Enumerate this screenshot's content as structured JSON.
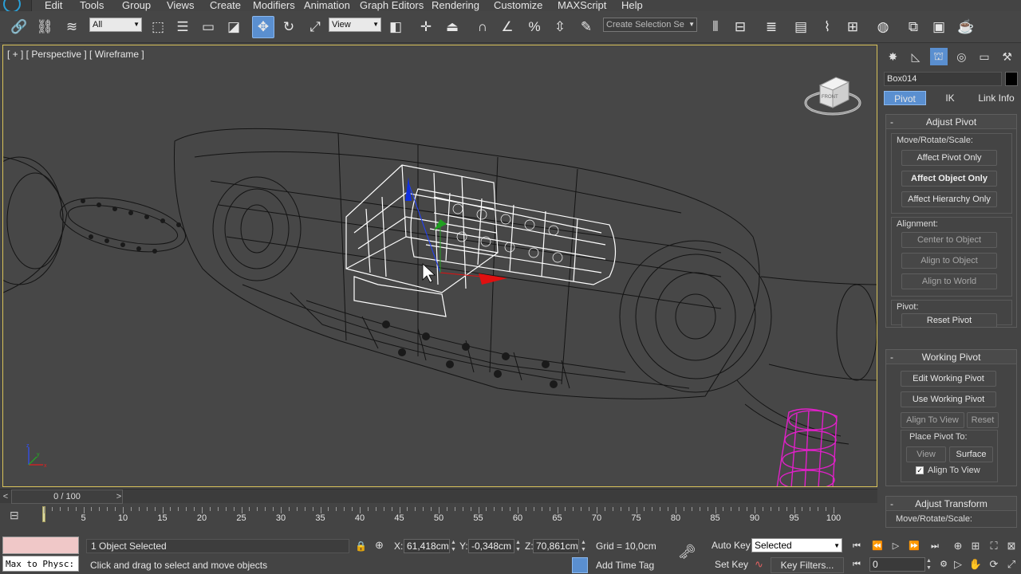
{
  "menu": [
    "Edit",
    "Tools",
    "Group",
    "Views",
    "Create",
    "Modifiers",
    "Animation",
    "Graph Editors",
    "Rendering",
    "Customize",
    "MAXScript",
    "Help"
  ],
  "toolbar": {
    "selection_filter": "All",
    "ref_coord": "View",
    "named_selection_set": "Create Selection Se"
  },
  "viewport": {
    "label": "[ + ] [ Perspective ] [ Wireframe ]",
    "viewcube_face": "FRONT",
    "axis_labels": [
      "x",
      "y",
      "z"
    ]
  },
  "command_panel": {
    "object_name": "Box014",
    "subtabs": [
      "Pivot",
      "IK",
      "Link Info"
    ],
    "active_subtab": "Pivot",
    "adjust_pivot": {
      "title": "Adjust Pivot",
      "move_label": "Move/Rotate/Scale:",
      "affect_pivot_only": "Affect Pivot Only",
      "affect_object_only": "Affect Object Only",
      "affect_hierarchy_only": "Affect Hierarchy Only",
      "alignment_label": "Alignment:",
      "center_to_object": "Center to Object",
      "align_to_object": "Align to Object",
      "align_to_world": "Align to World",
      "pivot_label": "Pivot:",
      "reset_pivot": "Reset Pivot"
    },
    "working_pivot": {
      "title": "Working Pivot",
      "edit_working_pivot": "Edit Working Pivot",
      "use_working_pivot": "Use Working Pivot",
      "align_to_view": "Align To View",
      "reset": "Reset",
      "place_pivot_label": "Place Pivot To:",
      "view": "View",
      "surface": "Surface",
      "align_to_view_checkbox": "Align To View",
      "align_to_view_checked": true
    },
    "adjust_transform": {
      "title": "Adjust Transform",
      "move_label": "Move/Rotate/Scale:"
    },
    "minus": "-"
  },
  "timeline": {
    "slider_text": "0 / 100",
    "prev": "<",
    "next": ">",
    "ticks": [
      5,
      10,
      15,
      20,
      25,
      30,
      35,
      40,
      45,
      50,
      55,
      60,
      65,
      70,
      75,
      80,
      85,
      90,
      95,
      100
    ],
    "current_frame": 0
  },
  "status": {
    "maxscript_listener": "Max to Physc:",
    "selection_count": "1 Object Selected",
    "prompt": "Click and drag to select and move objects",
    "x_label": "X:",
    "x_value": "61,418cm",
    "y_label": "Y:",
    "y_value": "-0,348cm",
    "z_label": "Z:",
    "z_value": "70,861cm",
    "grid": "Grid = 10,0cm",
    "add_time_tag": "Add Time Tag",
    "auto_key": "Auto Key",
    "set_key": "Set Key",
    "selected_dd": "Selected",
    "key_filters": "Key Filters...",
    "frame": "0"
  },
  "colors": {
    "accent": "#5a8fd0",
    "viewport_border": "#d8c25a",
    "selected_wire": "#ffffff",
    "pink_object": "#e020c8",
    "gizmo_x": "#e01010",
    "gizmo_y": "#20a020",
    "gizmo_z": "#1020e0"
  }
}
